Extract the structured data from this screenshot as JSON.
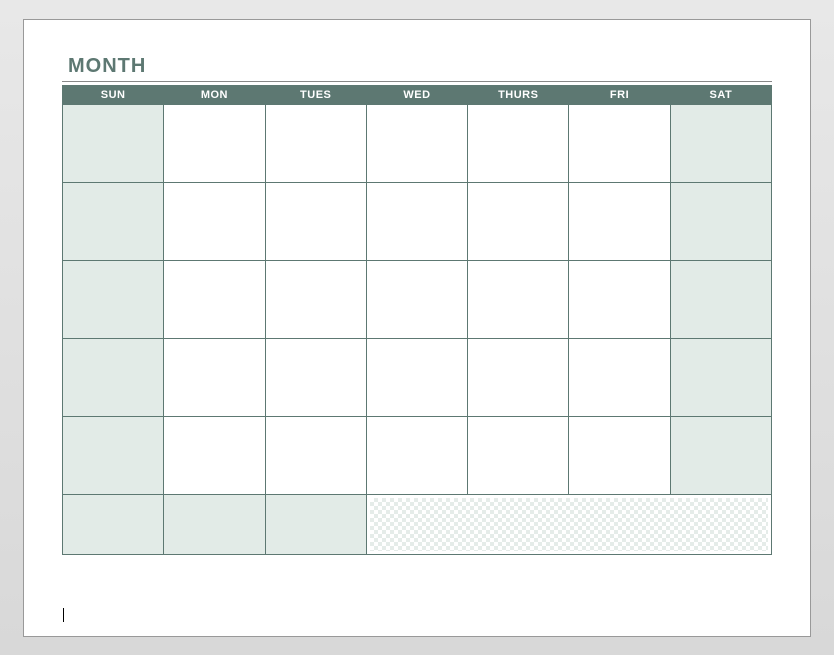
{
  "title": "MONTH",
  "days": {
    "sun": "SUN",
    "mon": "MON",
    "tue": "TUES",
    "wed": "WED",
    "thu": "THURS",
    "fri": "FRI",
    "sat": "SAT"
  },
  "colors": {
    "header_bg": "#5d7872",
    "weekend_bg": "#e2ebe7",
    "border": "#5d7872",
    "title": "#5d7872"
  },
  "grid": {
    "rows": 6,
    "columns": 7,
    "last_row_notes_span": 4
  }
}
